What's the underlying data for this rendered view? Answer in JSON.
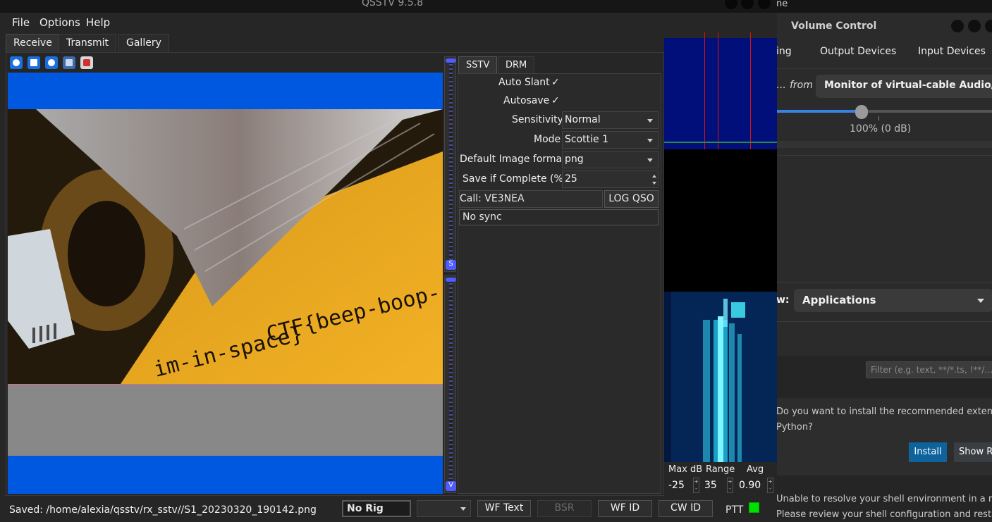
{
  "volume_control": {
    "top_strip_text": "ne",
    "title": "Volume Control",
    "tabs": [
      "ing",
      "Output Devices",
      "Input Devices"
    ],
    "from_ellipsis": "...",
    "from_label": "from",
    "device": "Monitor of virtual-cable Audio/Sink",
    "volume_label": "100% (0 dB)",
    "volume_fraction": 1.0,
    "show_label": "w:",
    "show_value": "Applications"
  },
  "vscode": {
    "filter_placeholder": "Filter (e.g. text, **/*.ts, !**/…",
    "notification_line1": "Do you want to install the recommended extensions fo",
    "notification_line2": "Python?",
    "install_label": "Install",
    "show_label": "Show Re",
    "error_line1": "Unable to resolve your shell environment in a reasona",
    "error_line2": "Please review your shell configuration and restart."
  },
  "qsstv": {
    "title": "QSSTV 9.5.8",
    "menu": [
      "File",
      "Options",
      "Help"
    ],
    "tabs": [
      "Receive",
      "Transmit",
      "Gallery"
    ],
    "active_tab": "Receive",
    "image": {
      "text_line1": "CTF{beep-boop-",
      "text_line2": "im-in-space}"
    },
    "slider_handle_label": "S",
    "slider_bottom_label": "V",
    "sstv_tabs": [
      "SSTV",
      "DRM"
    ],
    "settings": {
      "auto_slant_label": "Auto Slant",
      "auto_slant_check": "✓",
      "autosave_label": "Autosave",
      "autosave_check": "✓",
      "sensitivity_label": "Sensitivity",
      "sensitivity_value": "Normal",
      "mode_label": "Mode",
      "mode_value": "Scottie 1",
      "format_label": "Default Image format",
      "format_value": "png",
      "save_label": "Save if Complete (%)",
      "save_value": "25",
      "call_label": "Call: VE3NEA",
      "log_label": "LOG QSO",
      "sync_status": "No sync"
    },
    "waterfall": {
      "maxdb_label": "Max dB",
      "maxdb_value": "-25",
      "range_label": "Range",
      "range_value": "35",
      "avg_label": "Avg",
      "avg_value": "0.90"
    },
    "status": {
      "saved_text": "Saved: /home/alexia/qsstv/rx_sstv//S1_20230320_190142.png",
      "rig": "No Rig",
      "buttons": [
        "WF Text",
        "BSR",
        "WF ID",
        "CW ID"
      ],
      "ptt_label": "PTT"
    }
  },
  "colors": {
    "rx_blue": "#0057e0",
    "ptt_led": "#00e000",
    "accent_blue": "#3584e4",
    "install_blue": "#0e639c"
  }
}
